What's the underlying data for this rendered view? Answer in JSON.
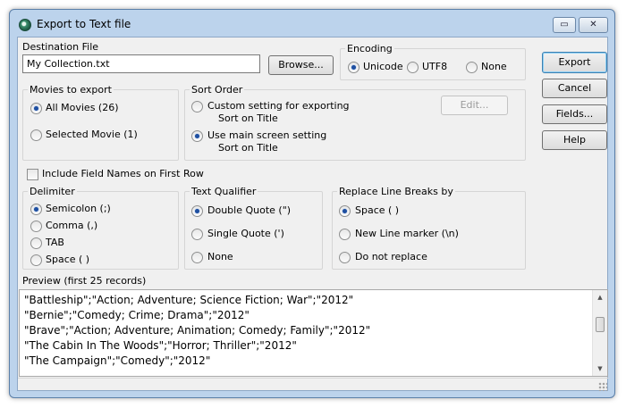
{
  "window": {
    "title": "Export to Text file",
    "restore_symbol": "▭",
    "close_symbol": "✕"
  },
  "destination": {
    "label": "Destination File",
    "value": "My Collection.txt",
    "browse_label": "Browse..."
  },
  "encoding": {
    "title": "Encoding",
    "options": [
      "Unicode",
      "UTF8",
      "None"
    ],
    "selected": "Unicode"
  },
  "buttons": {
    "export": "Export",
    "cancel": "Cancel",
    "fields": "Fields...",
    "help": "Help"
  },
  "movies_to_export": {
    "title": "Movies to export",
    "options": [
      "All Movies (26)",
      "Selected Movie (1)"
    ],
    "selected": "All Movies (26)"
  },
  "sort_order": {
    "title": "Sort Order",
    "custom_label": "Custom setting for exporting",
    "custom_sub": "Sort on Title",
    "main_label": "Use main screen setting",
    "main_sub": "Sort on Title",
    "selected": "Use main screen setting",
    "edit_label": "Edit..."
  },
  "include_field_names": {
    "label": "Include Field Names on First Row",
    "checked": false
  },
  "delimiter": {
    "title": "Delimiter",
    "options": [
      "Semicolon (;)",
      "Comma (,)",
      "TAB",
      "Space ( )"
    ],
    "selected": "Semicolon (;)"
  },
  "text_qualifier": {
    "title": "Text Qualifier",
    "options": [
      "Double Quote (\")",
      "Single Quote (')",
      "None"
    ],
    "selected": "Double Quote (\")"
  },
  "line_breaks": {
    "title": "Replace Line Breaks by",
    "options": [
      "Space ( )",
      "New Line marker (\\n)",
      "Do not replace"
    ],
    "selected": "Space ( )"
  },
  "preview": {
    "label": "Preview (first 25 records)",
    "lines": [
      "\"Battleship\";\"Action; Adventure; Science Fiction; War\";\"2012\"",
      "\"Bernie\";\"Comedy; Crime; Drama\";\"2012\"",
      "\"Brave\";\"Action; Adventure; Animation; Comedy; Family\";\"2012\"",
      "\"The Cabin In The Woods\";\"Horror; Thriller\";\"2012\"",
      "\"The Campaign\";\"Comedy\";\"2012\""
    ]
  }
}
